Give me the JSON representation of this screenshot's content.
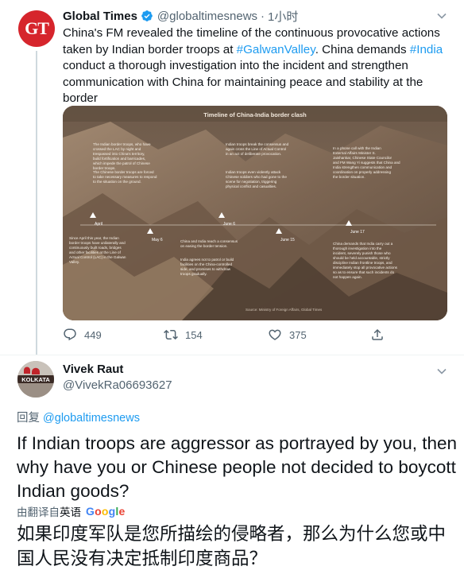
{
  "tweet1": {
    "avatar_text": "GT",
    "name": "Global Times",
    "handle": "@globaltimesnews",
    "dot": "·",
    "time": "1小时",
    "body_parts": [
      {
        "text": "China's FM revealed the timeline of the continuous provocative actions taken by Indian border troops at ",
        "link": false
      },
      {
        "text": "#GalwanValley",
        "link": true
      },
      {
        "text": ". China demands ",
        "link": false
      },
      {
        "text": "#India",
        "link": true
      },
      {
        "text": " conduct a thorough investigation into the incident and strengthen communication with China for maintaining peace and stability at the border",
        "link": false
      }
    ],
    "infographic": {
      "title": "Timeline of China-India border clash",
      "markers": [
        "April",
        "May 6",
        "June 6",
        "June 15",
        "June 17"
      ],
      "notes": [
        "The Indian border troops, who have crossed the LAC by night and trespassed into China's territory, build fortification and barricades, which impede the patrol of Chinese border troops.",
        "The Chinese border troops are forced to take necessary measures to respond to the situation on the ground.",
        "Since April this year, the Indian border troops have unilaterally and continuously built roads, bridges and other facilities at the Line of Actual Control (LAC) in the Galwan Valley.",
        "Indian troops break the consensus and again cross the Line of Actual Control in an act of deliberate provocation.",
        "Indian troops even violently attack Chinese soldiers who had gone to the scene for negotiation, triggering physical conflict and casualties.",
        "China and India reach a consensus on easing the border tension.",
        "India agrees not to patrol or build facilities on the China-controlled side, and promises to withdraw troops gradually.",
        "In a phone call with the Indian External Affairs Minister S. Jaishankar, Chinese State Councilor and FM Wang Yi suggests that China and India strengthen communication and coordination on properly addressing the border situation.",
        "China demands that India carry out a thorough investigation into the incident, severely punish those who should be held accountable, strictly discipline Indian frontline troops, and immediately stop all provocative actions so as to ensure that such incidents do not happen again."
      ],
      "source": "Source: Ministry of Foreign Affairs, Global Times"
    },
    "actions": {
      "reply_count": "449",
      "retweet_count": "154",
      "like_count": "375"
    }
  },
  "tweet2": {
    "avatar_text": "KOLKATA",
    "name": "Vivek Raut",
    "handle": "@VivekRa06693627",
    "reply_prefix": "回复 ",
    "reply_to": "@globaltimesnews",
    "body": "If Indian troops are aggressor as portrayed by you, then why have you or Chinese people  not decided to boycott Indian goods?",
    "translate_label": "由翻译自 ",
    "translate_lang": "英语",
    "google_letters": [
      "G",
      "o",
      "o",
      "g",
      "l",
      "e"
    ],
    "translation": "如果印度军队是您所描绘的侵略者，那么为什么您或中国人民没有决定抵制印度商品？"
  },
  "colors": {
    "link": "#1d9bf0",
    "secondary_text": "#536471",
    "gt_red": "#d6252c"
  },
  "icons": [
    "verified-badge-icon",
    "chevron-down-icon",
    "reply-icon",
    "retweet-icon",
    "like-icon",
    "share-icon"
  ]
}
